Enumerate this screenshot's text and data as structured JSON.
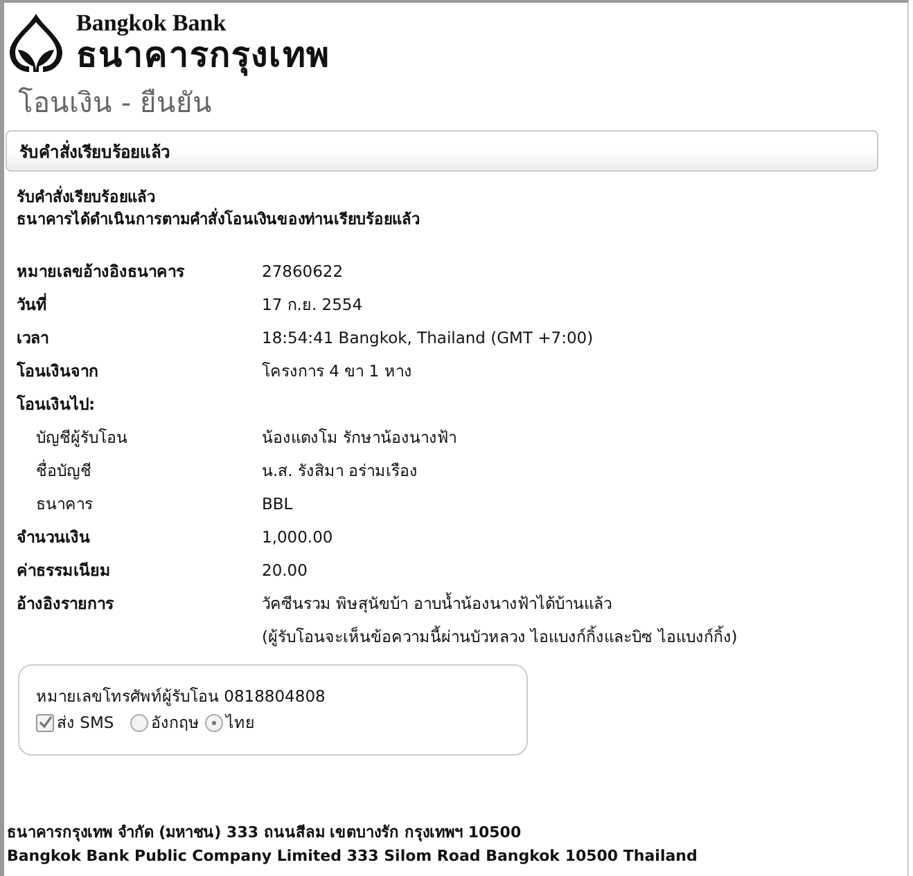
{
  "logo": {
    "name": "Bangkok Bank",
    "thai_name": "ธนาคารกรุงเทพ"
  },
  "title": "โอนเงิน - ยืนยัน",
  "section": {
    "title": "รับคำสั่งเรียบร้อยแล้ว"
  },
  "messages": [
    "รับคำสั่งเรียบร้อยแล้ว",
    "ธนาคารได้ดำเนินการตามคำสั่งโอนเงินของท่านเรียบร้อยแล้ว"
  ],
  "details": [
    {
      "kind": "field",
      "label": "หมายเลขอ้างอิงธนาคาร",
      "values": [
        "27860622"
      ]
    },
    {
      "kind": "field",
      "label": "วันที่",
      "values": [
        "17 ก.ย. 2554"
      ]
    },
    {
      "kind": "field",
      "label": "เวลา",
      "values": [
        "18:54:41 Bangkok, Thailand (GMT +7:00)"
      ]
    },
    {
      "kind": "field",
      "label": "โอนเงินจาก",
      "values": [
        "โครงการ 4 ขา 1 หาง"
      ]
    },
    {
      "kind": "group",
      "label": "โอนเงินไป:"
    },
    {
      "kind": "subfield",
      "label": "บัญชีผู้รับโอน",
      "values": [
        "น้องแตงโม รักษาน้องนางฟ้า"
      ]
    },
    {
      "kind": "subfield",
      "label": "ชื่อบัญชี",
      "values": [
        "น.ส. รังสิมา อร่ามเรือง"
      ]
    },
    {
      "kind": "subfield",
      "label": "ธนาคาร",
      "values": [
        "BBL"
      ]
    },
    {
      "kind": "field",
      "label": "จำนวนเงิน",
      "values": [
        "1,000.00"
      ]
    },
    {
      "kind": "field",
      "label": "ค่าธรรมเนียม",
      "values": [
        "20.00"
      ]
    },
    {
      "kind": "field",
      "label": "อ้างอิงรายการ",
      "values": [
        "วัคซีนรวม พิษสุนัขบ้า อาบน้ำน้องนางฟ้าได้บ้านแล้ว",
        "(ผู้รับโอนจะเห็นข้อความนี้ผ่านบัวหลวง ไอแบงก์กิ้งและบิซ ไอแบงก์กิ้ง)"
      ]
    }
  ],
  "sms_box": {
    "phone": "หมายเลขโทรศัพท์ผู้รับโอน 0818804808",
    "checkbox": {
      "label": "ส่ง SMS",
      "checked": true
    },
    "languages": [
      {
        "label": "อังกฤษ",
        "selected": false
      },
      {
        "label": "ไทย",
        "selected": true
      }
    ]
  },
  "footer": [
    "ธนาคารกรุงเทพ จำกัด (มหาชน)  333 ถนนสีลม เขตบางรัก กรุงเทพฯ 10500",
    "Bangkok Bank Public Company Limited 333 Silom Road Bangkok 10500 Thailand"
  ]
}
